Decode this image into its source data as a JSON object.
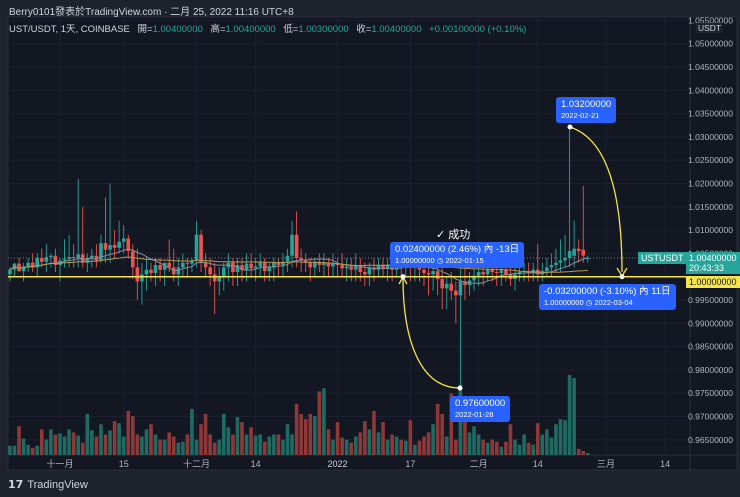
{
  "header": {
    "publisher": "Berry0101發表於TradingView.com · 二月 25, 2022 11:16 UTC+8"
  },
  "legend": {
    "symbol": "UST/USDT, 1天, COINBASE",
    "open_label": "開=",
    "open": "1.00400000",
    "high_label": "高=",
    "high": "1.00400000",
    "low_label": "低=",
    "low": "1.00300000",
    "close_label": "收=",
    "close": "1.00400000",
    "change": "+0.00100000 (+0.10%)"
  },
  "price_axis": {
    "currency": "USDT",
    "ticks": [
      "1.05500000",
      "1.05000000",
      "1.04500000",
      "1.04000000",
      "1.03500000",
      "1.03000000",
      "1.02500000",
      "1.02000000",
      "1.01500000",
      "1.01000000",
      "1.00500000",
      "0.99500000",
      "0.99000000",
      "0.98500000",
      "0.98000000",
      "0.97500000",
      "0.97000000",
      "0.96500000"
    ]
  },
  "price_tags": {
    "symbol": "USTUSDT",
    "last_price": "1.00400000",
    "countdown": "20:43:33",
    "hline_price": "1.00000000"
  },
  "annotations": {
    "high_label": {
      "price": "1.03200000",
      "date": "2022-02-21"
    },
    "low_label": {
      "price": "0.97600000",
      "date": "2022-01-28"
    },
    "range_left": {
      "line1": "0.02400000 (2.46%) 內 -13日",
      "price": "1.00000000",
      "date": "2022-01-15"
    },
    "range_right": {
      "line1": "-0.03200000 (-3.10%) 內 11日",
      "price": "1.00000000",
      "date": "2022-03-04"
    },
    "success": "✓ 成功"
  },
  "footer": {
    "brand": "TradingView"
  },
  "colors": {
    "up": "#26a69a",
    "down": "#ef5350",
    "hline": "#f5e44a",
    "label": "#2962ff",
    "bg": "#131722"
  },
  "chart_data": {
    "type": "candlestick",
    "title": "UST/USDT, 1天, COINBASE",
    "start_date": "2021-10-21",
    "fields": [
      "open",
      "high",
      "low",
      "close",
      "volume_relative"
    ],
    "ylim": [
      0.962,
      1.056
    ],
    "horizontal_line": 1.0,
    "x_ticks": [
      {
        "label": "十一月",
        "day": 11
      },
      {
        "label": "15",
        "day": 25
      },
      {
        "label": "十二月",
        "day": 41
      },
      {
        "label": "14",
        "day": 54
      },
      {
        "label": "2022",
        "day": 72
      },
      {
        "label": "17",
        "day": 88
      },
      {
        "label": "二月",
        "day": 103
      },
      {
        "label": "14",
        "day": 116
      },
      {
        "label": "三月",
        "day": 131
      },
      {
        "label": "14",
        "day": 144
      }
    ],
    "candles": [
      [
        1.0005,
        1.002,
        0.999,
        1.0015,
        9
      ],
      [
        1.0015,
        1.003,
        1.0,
        1.0028,
        9
      ],
      [
        1.0028,
        1.004,
        1.001,
        1.0012,
        28
      ],
      [
        1.0012,
        1.003,
        0.999,
        1.0022,
        16
      ],
      [
        1.0022,
        1.004,
        1.001,
        1.003,
        10
      ],
      [
        1.003,
        1.005,
        1.001,
        1.002,
        7
      ],
      [
        1.002,
        1.005,
        1.0,
        1.004,
        9
      ],
      [
        1.004,
        1.006,
        1.002,
        1.0032,
        25
      ],
      [
        1.0032,
        1.007,
        1.001,
        1.0042,
        15
      ],
      [
        1.0042,
        1.005,
        1.002,
        1.0045,
        25
      ],
      [
        1.0045,
        1.006,
        1.001,
        1.0025,
        20
      ],
      [
        1.0025,
        1.004,
        0.999,
        1.0035,
        21
      ],
      [
        1.0035,
        1.008,
        1.002,
        1.0038,
        18
      ],
      [
        1.0038,
        1.009,
        1.002,
        1.0042,
        25
      ],
      [
        1.0042,
        1.007,
        1.002,
        1.004,
        22
      ],
      [
        1.004,
        1.021,
        1.002,
        1.0048,
        19
      ],
      [
        1.0048,
        1.015,
        1.002,
        1.003,
        12
      ],
      [
        1.003,
        1.005,
        1.001,
        1.004,
        40
      ],
      [
        1.004,
        1.006,
        1.002,
        1.0045,
        24
      ],
      [
        1.0045,
        1.007,
        1.002,
        1.0035,
        18
      ],
      [
        1.0035,
        1.009,
        1.003,
        1.0072,
        30
      ],
      [
        1.0072,
        1.017,
        1.003,
        1.0058,
        20
      ],
      [
        1.0058,
        1.02,
        1.003,
        1.0068,
        24
      ],
      [
        1.0068,
        1.01,
        1.004,
        1.0062,
        33
      ],
      [
        1.0062,
        1.012,
        1.005,
        1.0075,
        31
      ],
      [
        1.0075,
        1.011,
        1.005,
        1.0082,
        18
      ],
      [
        1.0082,
        1.009,
        1.004,
        1.0055,
        43
      ],
      [
        1.0055,
        1.007,
        0.9995,
        1.002,
        38
      ],
      [
        1.002,
        1.006,
        0.995,
        0.999,
        20
      ],
      [
        0.999,
        1.003,
        0.994,
        1.0005,
        18
      ],
      [
        1.0005,
        1.004,
        0.997,
        1.0015,
        25
      ],
      [
        1.0015,
        1.003,
        0.999,
        1.0008,
        30
      ],
      [
        1.0008,
        1.004,
        0.998,
        1.0025,
        20
      ],
      [
        1.0025,
        1.004,
        0.999,
        1.0015,
        15
      ],
      [
        1.0015,
        1.003,
        0.998,
        1.003,
        15
      ],
      [
        1.003,
        1.008,
        1.001,
        1.002,
        22
      ],
      [
        1.002,
        1.006,
        0.999,
        1.0005,
        18
      ],
      [
        1.0005,
        1.004,
        0.998,
        1.002,
        12
      ],
      [
        1.002,
        1.005,
        1.0,
        1.003,
        13
      ],
      [
        1.003,
        1.004,
        1.0,
        1.0028,
        20
      ],
      [
        1.0028,
        1.004,
        1.001,
        1.0035,
        45
      ],
      [
        1.0035,
        1.012,
        1.002,
        1.009,
        15
      ],
      [
        1.009,
        1.01,
        1.001,
        1.003,
        30
      ],
      [
        1.003,
        1.005,
        1.0,
        1.002,
        40
      ],
      [
        1.002,
        1.004,
        0.998,
        1.0005,
        20
      ],
      [
        1.0005,
        1.003,
        0.992,
        0.999,
        12
      ],
      [
        0.999,
        1.002,
        0.996,
        1.0,
        15
      ],
      [
        1.0,
        1.003,
        0.997,
        1.002,
        40
      ],
      [
        1.002,
        1.005,
        0.999,
        1.003,
        27
      ],
      [
        1.003,
        1.004,
        0.998,
        1.001,
        20
      ],
      [
        1.001,
        1.004,
        0.998,
        1.0025,
        37
      ],
      [
        1.0025,
        1.004,
        0.999,
        1.0015,
        32
      ],
      [
        1.0015,
        1.005,
        0.999,
        1.0028,
        20
      ],
      [
        1.0028,
        1.005,
        1.0,
        1.0018,
        27
      ],
      [
        1.0018,
        1.004,
        0.999,
        1.0022,
        19
      ],
      [
        1.0022,
        1.005,
        1.0,
        1.003,
        20
      ],
      [
        1.003,
        1.004,
        0.999,
        1.0012,
        13
      ],
      [
        1.0012,
        1.003,
        0.999,
        1.002,
        18
      ],
      [
        1.002,
        1.004,
        0.999,
        1.003,
        20
      ],
      [
        1.003,
        1.004,
        1.0,
        1.0025,
        20
      ],
      [
        1.0025,
        1.005,
        1.0,
        1.0032,
        15
      ],
      [
        1.0032,
        1.006,
        1.001,
        1.0045,
        30
      ],
      [
        1.0045,
        1.012,
        1.002,
        1.009,
        20
      ],
      [
        1.009,
        1.014,
        1.002,
        1.004,
        50
      ],
      [
        1.004,
        1.006,
        1.001,
        1.0035,
        40
      ],
      [
        1.0035,
        1.005,
        1.001,
        1.003,
        35
      ],
      [
        1.003,
        1.004,
        0.999,
        1.002,
        40
      ],
      [
        1.002,
        1.004,
        1.0,
        1.0032,
        38
      ],
      [
        1.0032,
        1.005,
        1.001,
        1.0025,
        62
      ],
      [
        1.0025,
        1.005,
        1.0,
        1.003,
        65
      ],
      [
        1.003,
        1.004,
        1.0,
        1.0022,
        25
      ],
      [
        1.0022,
        1.005,
        1.0,
        1.0028,
        15
      ],
      [
        1.0028,
        1.004,
        1.0,
        1.0025,
        32
      ],
      [
        1.0025,
        1.005,
        1.0,
        1.0018,
        17
      ],
      [
        1.0018,
        1.004,
        0.999,
        1.0022,
        15
      ],
      [
        1.0022,
        1.004,
        0.999,
        1.0015,
        12
      ],
      [
        1.0015,
        1.005,
        0.999,
        1.0025,
        18
      ],
      [
        1.0025,
        1.004,
        0.999,
        1.001,
        22
      ],
      [
        1.001,
        1.003,
        0.998,
        1.0005,
        33
      ],
      [
        1.0005,
        1.003,
        0.998,
        1.002,
        25
      ],
      [
        1.002,
        1.004,
        0.999,
        1.0015,
        43
      ],
      [
        1.0015,
        1.004,
        1.0,
        1.0025,
        22
      ],
      [
        1.0025,
        1.004,
        1.0,
        1.0018,
        32
      ],
      [
        1.0018,
        1.004,
        0.999,
        1.0025,
        15
      ],
      [
        1.0025,
        1.005,
        0.999,
        1.0015,
        20
      ],
      [
        1.0015,
        1.004,
        1.0,
        1.003,
        18
      ],
      [
        1.003,
        1.005,
        1.0,
        1.0024,
        15
      ],
      [
        1.0024,
        1.005,
        1.0,
        1.0028,
        14
      ],
      [
        1.0028,
        1.004,
        0.999,
        1.002,
        34
      ],
      [
        1.002,
        1.004,
        0.999,
        1.0025,
        10
      ],
      [
        1.0025,
        1.006,
        0.999,
        1.0015,
        14
      ],
      [
        1.0015,
        1.004,
        0.998,
        1.0008,
        18
      ],
      [
        1.0008,
        1.003,
        0.996,
        1.0005,
        22
      ],
      [
        1.0005,
        1.003,
        0.997,
        1.0012,
        30
      ],
      [
        1.0012,
        1.004,
        0.996,
        0.9995,
        50
      ],
      [
        0.9995,
        1.002,
        0.993,
        0.9975,
        40
      ],
      [
        0.9975,
        1.0,
        0.993,
        0.9985,
        18
      ],
      [
        0.9985,
        1.001,
        0.995,
        0.997,
        60
      ],
      [
        0.997,
        0.999,
        0.99,
        0.996,
        15
      ],
      [
        0.996,
        1.002,
        0.976,
        0.999,
        68
      ],
      [
        0.999,
        1.002,
        0.995,
        0.9982,
        35
      ],
      [
        0.9982,
        1.001,
        0.996,
        0.9992,
        22
      ],
      [
        0.9992,
        1.002,
        0.997,
        1.0002,
        28
      ],
      [
        1.0002,
        1.003,
        0.998,
        1.001,
        20
      ],
      [
        1.001,
        1.003,
        0.998,
        1.0005,
        15
      ],
      [
        1.0005,
        1.003,
        0.999,
        1.0015,
        12
      ],
      [
        1.0015,
        1.003,
        0.999,
        1.001,
        15
      ],
      [
        1.001,
        1.003,
        0.998,
        1.0008,
        13
      ],
      [
        1.0008,
        1.003,
        0.998,
        1.0014,
        8
      ],
      [
        1.0014,
        1.003,
        0.999,
        1.0005,
        13
      ],
      [
        1.0005,
        1.003,
        0.998,
        0.9995,
        30
      ],
      [
        0.9995,
        1.002,
        0.997,
        1.0005,
        15
      ],
      [
        1.0005,
        1.003,
        0.999,
        1.001,
        10
      ],
      [
        1.001,
        1.003,
        0.999,
        1.0012,
        20
      ],
      [
        1.0012,
        1.003,
        0.999,
        1.0008,
        12
      ],
      [
        1.0008,
        1.003,
        0.999,
        1.0015,
        10
      ],
      [
        1.0015,
        1.007,
        0.999,
        1.0005,
        31
      ],
      [
        1.0005,
        1.003,
        0.999,
        1.0012,
        20
      ],
      [
        1.0012,
        1.004,
        1.0,
        1.002,
        25
      ],
      [
        1.002,
        1.005,
        1.0,
        1.0025,
        17
      ],
      [
        1.0025,
        1.006,
        1.001,
        1.003,
        30
      ],
      [
        1.003,
        1.008,
        1.001,
        1.0035,
        35
      ],
      [
        1.0035,
        1.009,
        1.002,
        1.004,
        34
      ],
      [
        1.004,
        1.032,
        1.002,
        1.0055,
        78
      ],
      [
        1.0045,
        1.012,
        1.002,
        1.006,
        75
      ],
      [
        1.006,
        1.008,
        1.003,
        1.0055,
        6
      ],
      [
        1.0058,
        1.0195,
        1.003,
        1.0045,
        4
      ],
      [
        1.004,
        1.0045,
        1.003,
        1.004,
        2
      ]
    ]
  }
}
